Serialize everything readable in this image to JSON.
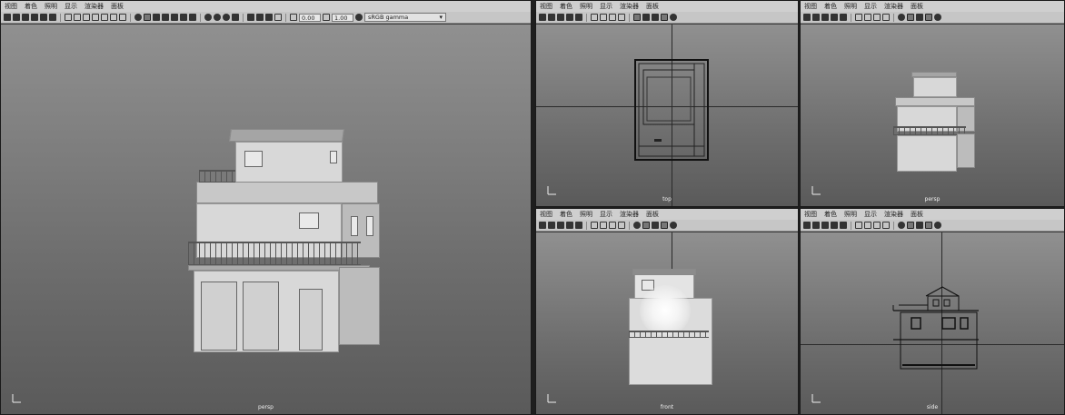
{
  "menus": [
    "视图",
    "着色",
    "照明",
    "显示",
    "渲染器",
    "面板"
  ],
  "toolbar": {
    "exposure": "0.00",
    "gamma": "1.00",
    "color_space": "sRGB gamma"
  },
  "panels": [
    {
      "id": "main",
      "camera": "persp"
    },
    {
      "id": "top",
      "camera": "top"
    },
    {
      "id": "persp2",
      "camera": "persp"
    },
    {
      "id": "front",
      "camera": "front"
    },
    {
      "id": "side",
      "camera": "side"
    }
  ],
  "icons": [
    "camera-icon",
    "select-icon",
    "lasso-icon",
    "paint-icon",
    "grid-icon",
    "wireframe-icon",
    "smooth-shade-icon",
    "texture-icon",
    "light-icon",
    "shadow-icon",
    "isolate-icon",
    "exposure-icon",
    "gamma-icon",
    "color-space-icon"
  ]
}
